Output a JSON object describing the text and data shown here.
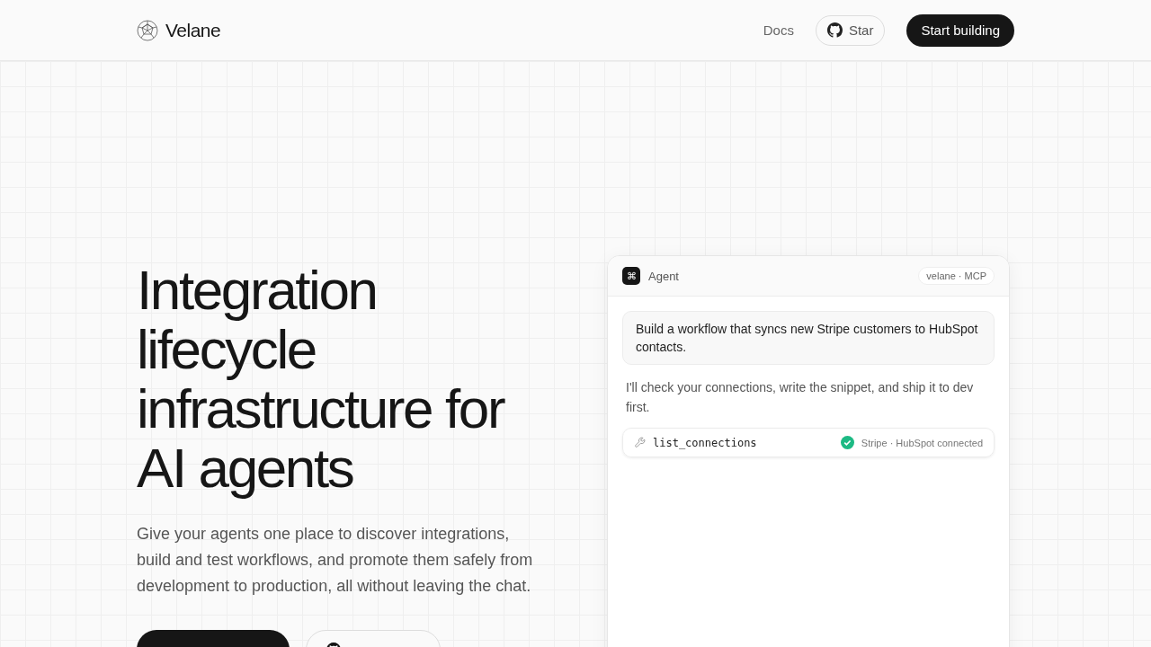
{
  "nav": {
    "brand": "Velane",
    "links": [
      {
        "label": "Docs"
      }
    ],
    "star_button": "Star",
    "cta": "Start building"
  },
  "hero": {
    "title": "Integration lifecycle infrastructure for AI agents",
    "subtitle": "Give your agents one place to discover integrations, build and test workflows, and promote them safely from development to production, all without leaving the chat.",
    "buttons": [
      {
        "kind": "primary"
      },
      {
        "kind": "github"
      }
    ]
  },
  "agent_card": {
    "icon": "⌘",
    "title": "Agent",
    "badge": "velane · MCP",
    "messages": [
      {
        "kind": "user",
        "text": "Build a workflow that syncs new Stripe customers to HubSpot contacts."
      },
      {
        "kind": "agent",
        "text": "I'll check your connections, write the snippet, and ship it to dev first."
      },
      {
        "kind": "tool",
        "name": "list_connections",
        "status": "Stripe · HubSpot connected",
        "ok": true
      }
    ]
  }
}
